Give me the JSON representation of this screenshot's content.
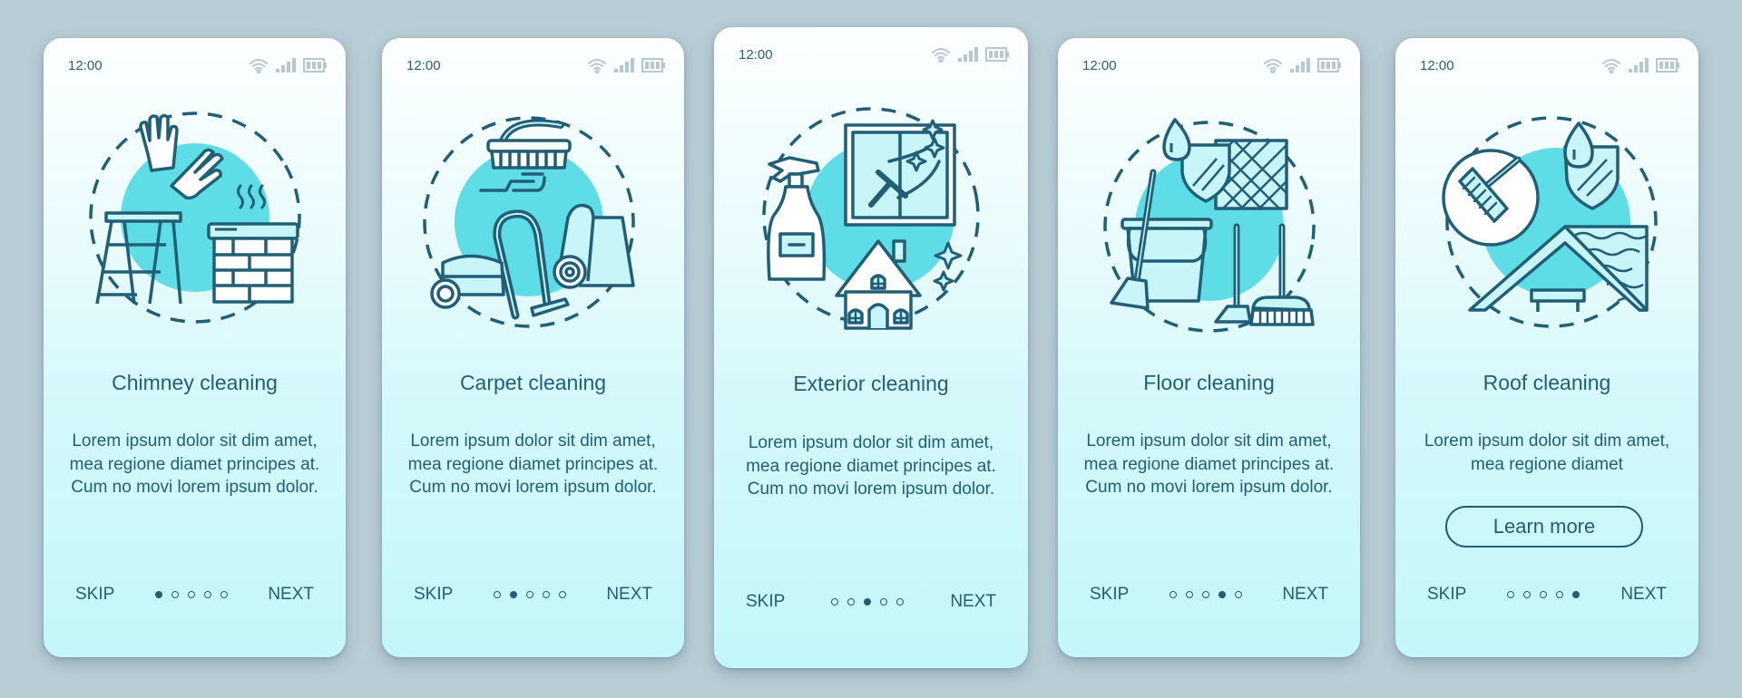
{
  "theme": {
    "background": "#b8ccd6",
    "ink": "#215f76",
    "accent_fill": "#5fdde6",
    "light_fill": "#c8f6f8",
    "status_icon_color": "#b5c8d2"
  },
  "screens": [
    {
      "time": "12:00",
      "illustration": "chimney-cleaning-illustration",
      "title": "Chimney cleaning",
      "description": "Lorem ipsum dolor sit dim amet, mea regione diamet principes at. Cum no movi lorem ipsum dolor.",
      "skip": "SKIP",
      "next": "NEXT",
      "active_page": 1,
      "page_count": 5
    },
    {
      "time": "12:00",
      "illustration": "carpet-cleaning-illustration",
      "title": "Carpet cleaning",
      "description": "Lorem ipsum dolor sit dim amet, mea regione diamet principes at. Cum no movi lorem ipsum dolor.",
      "skip": "SKIP",
      "next": "NEXT",
      "active_page": 2,
      "page_count": 5
    },
    {
      "time": "12:00",
      "illustration": "exterior-cleaning-illustration",
      "title": "Exterior cleaning",
      "description": "Lorem ipsum dolor sit dim amet, mea regione diamet principes at. Cum no movi lorem ipsum dolor.",
      "skip": "SKIP",
      "next": "NEXT",
      "active_page": 3,
      "page_count": 5
    },
    {
      "time": "12:00",
      "illustration": "floor-cleaning-illustration",
      "title": "Floor cleaning",
      "description": "Lorem ipsum dolor sit dim amet, mea regione diamet principes at. Cum no movi lorem ipsum dolor.",
      "skip": "SKIP",
      "next": "NEXT",
      "active_page": 4,
      "page_count": 5
    },
    {
      "time": "12:00",
      "illustration": "roof-cleaning-illustration",
      "title": "Roof cleaning",
      "description": "Lorem ipsum dolor sit dim amet, mea regione diamet",
      "cta": "Learn more",
      "skip": "SKIP",
      "next": "NEXT",
      "active_page": 5,
      "page_count": 5
    }
  ],
  "status_icons": [
    "wifi-icon",
    "signal-icon",
    "battery-icon"
  ]
}
